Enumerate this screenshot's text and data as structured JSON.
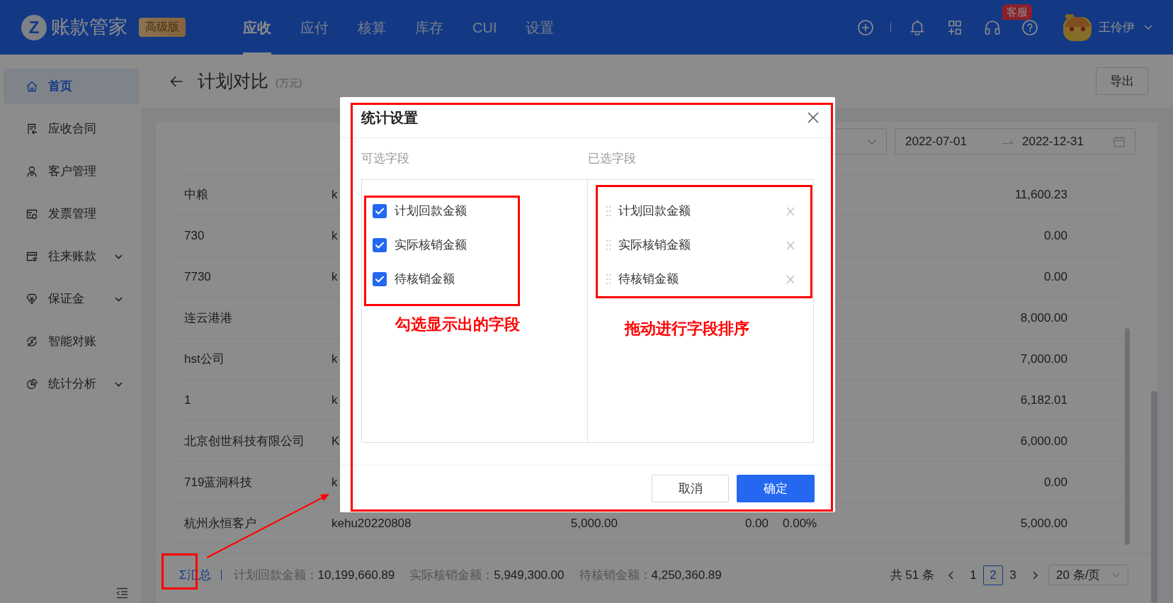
{
  "header": {
    "logo_mark": "Z",
    "logo_text": "账款管家",
    "edition_badge": "高级版",
    "nav": [
      {
        "label": "应收",
        "selected": true
      },
      {
        "label": "应付",
        "selected": false
      },
      {
        "label": "核算",
        "selected": false
      },
      {
        "label": "库存",
        "selected": false
      },
      {
        "label": "CUI",
        "selected": false
      },
      {
        "label": "设置",
        "selected": false
      }
    ],
    "support_badge": "客服",
    "user_name": "王伶伊"
  },
  "sidebar": {
    "items": [
      {
        "label": "首页",
        "selected": true,
        "has_submenu": false
      },
      {
        "label": "应收合同",
        "selected": false,
        "has_submenu": false
      },
      {
        "label": "客户管理",
        "selected": false,
        "has_submenu": false
      },
      {
        "label": "发票管理",
        "selected": false,
        "has_submenu": false
      },
      {
        "label": "往来账款",
        "selected": false,
        "has_submenu": true
      },
      {
        "label": "保证金",
        "selected": false,
        "has_submenu": true
      },
      {
        "label": "智能对账",
        "selected": false,
        "has_submenu": false
      },
      {
        "label": "统计分析",
        "selected": false,
        "has_submenu": true
      }
    ]
  },
  "page": {
    "title": "计划对比",
    "unit": "(万元)",
    "export_button": "导出"
  },
  "filters": {
    "date_start": "2022-07-01",
    "date_end": "2022-12-31"
  },
  "table": {
    "rows": [
      {
        "column_1": "中粮",
        "column_2": "k",
        "column_6": "11,600.23"
      },
      {
        "column_1": "730",
        "column_2": "k",
        "column_6": "0.00"
      },
      {
        "column_1": "7730",
        "column_2": "k",
        "column_6": "0.00"
      },
      {
        "column_1": "连云港港",
        "column_6": "8,000.00"
      },
      {
        "column_1": "hst公司",
        "column_2": "k",
        "column_6": "7,000.00"
      },
      {
        "column_1": "1",
        "column_2": "k",
        "column_6": "6,182.01"
      },
      {
        "column_1": "北京创世科技有限公司",
        "column_2": "K",
        "column_6": "6,000.00"
      },
      {
        "column_1": "719蓝洞科技",
        "column_2": "k",
        "column_6": "0.00"
      },
      {
        "column_1": "杭州永恒客户",
        "column_2": "kehu20220808",
        "column_3": "5,000.00",
        "column_4": "0.00",
        "column_5": "0.00%",
        "column_6": "5,000.00"
      }
    ]
  },
  "summary": {
    "label": "Σ汇总",
    "totals": [
      {
        "label": "计划回款金额：",
        "value": "10,199,660.89"
      },
      {
        "label": "实际核销金额：",
        "value": "5,949,300.00"
      },
      {
        "label": "待核销金额：",
        "value": "4,250,360.89"
      }
    ]
  },
  "pagination": {
    "total": "共 51 条",
    "pages": [
      {
        "label": "1",
        "selected": false
      },
      {
        "label": "2",
        "selected": true
      },
      {
        "label": "3",
        "selected": false
      }
    ],
    "page_size": "20 条/页"
  },
  "dialog": {
    "title": "统计设置",
    "available_title": "可选字段",
    "selected_title": "已选字段",
    "available_fields": [
      {
        "label": "计划回款金额",
        "checked": true
      },
      {
        "label": "实际核销金额",
        "checked": true
      },
      {
        "label": "待核销金额",
        "checked": true
      }
    ],
    "selected_fields": [
      {
        "label": "计划回款金额"
      },
      {
        "label": "实际核销金额"
      },
      {
        "label": "待核销金额"
      }
    ],
    "cancel_button": "取消",
    "confirm_button": "确定"
  },
  "annotations": {
    "left_note": "勾选显示出的字段",
    "right_note": "拖动进行字段排序"
  }
}
